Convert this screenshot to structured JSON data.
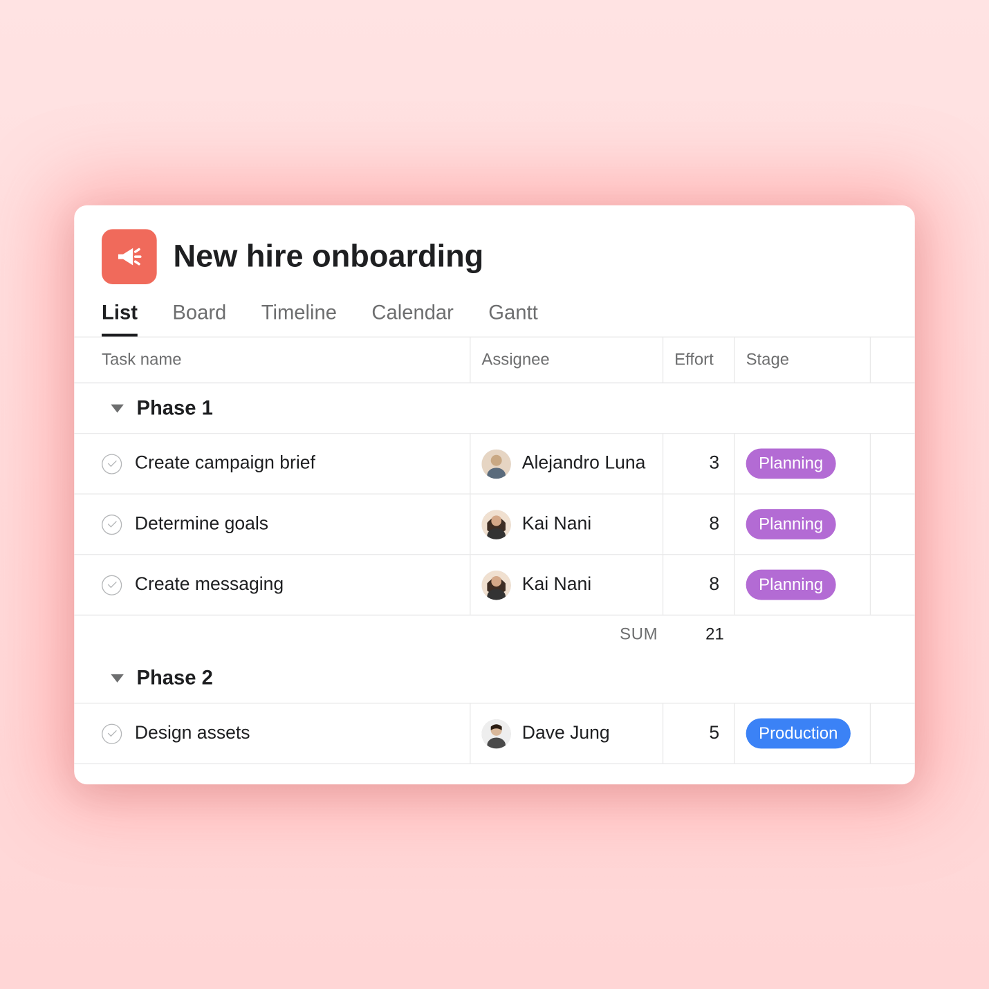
{
  "project": {
    "title": "New hire onboarding"
  },
  "tabs": [
    {
      "label": "List",
      "active": true
    },
    {
      "label": "Board",
      "active": false
    },
    {
      "label": "Timeline",
      "active": false
    },
    {
      "label": "Calendar",
      "active": false
    },
    {
      "label": "Gantt",
      "active": false
    }
  ],
  "columns": {
    "task": "Task name",
    "assignee": "Assignee",
    "effort": "Effort",
    "stage": "Stage"
  },
  "sections": [
    {
      "name": "Phase 1",
      "tasks": [
        {
          "name": "Create campaign brief",
          "assignee": "Alejandro Luna",
          "avatar": "person1",
          "effort": "3",
          "stage": "Planning",
          "stage_color": "purple"
        },
        {
          "name": "Determine goals",
          "assignee": "Kai Nani",
          "avatar": "person2",
          "effort": "8",
          "stage": "Planning",
          "stage_color": "purple"
        },
        {
          "name": "Create messaging",
          "assignee": "Kai Nani",
          "avatar": "person2",
          "effort": "8",
          "stage": "Planning",
          "stage_color": "purple"
        }
      ],
      "sum_label": "SUM",
      "sum_value": "21"
    },
    {
      "name": "Phase 2",
      "tasks": [
        {
          "name": "Design assets",
          "assignee": "Dave Jung",
          "avatar": "person3",
          "effort": "5",
          "stage": "Production",
          "stage_color": "blue"
        }
      ]
    }
  ]
}
